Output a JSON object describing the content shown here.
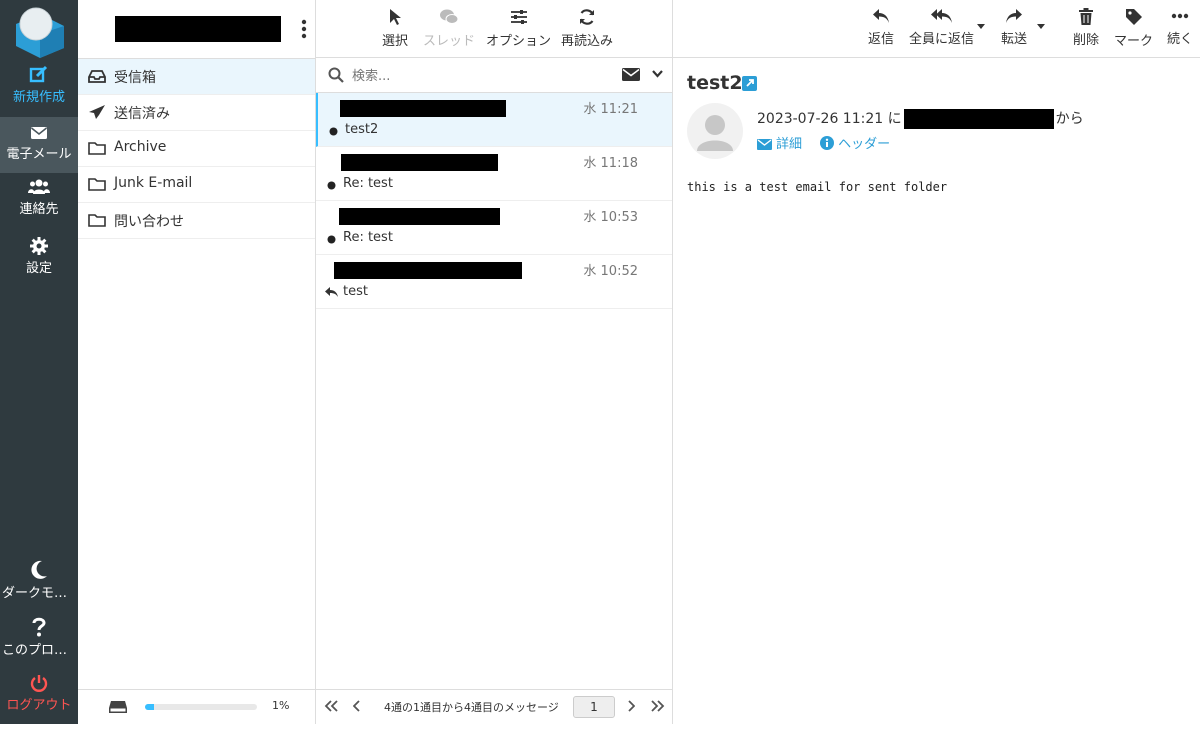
{
  "nav": {
    "compose": "新規作成",
    "mail": "電子メール",
    "contacts": "連絡先",
    "settings": "設定",
    "darkmode": "ダークモー…",
    "about": "このプログ…",
    "logout": "ログアウト"
  },
  "folders": {
    "items": [
      {
        "label": "受信箱",
        "icon": "inbox-icon"
      },
      {
        "label": "送信済み",
        "icon": "paper-plane-icon"
      },
      {
        "label": "Archive",
        "icon": "folder-icon"
      },
      {
        "label": "Junk E-mail",
        "icon": "folder-icon"
      },
      {
        "label": "問い合わせ",
        "icon": "folder-icon"
      }
    ],
    "quota": {
      "percent_label": "1%",
      "fraction": 0.08
    }
  },
  "list": {
    "toolbar": {
      "select": "選択",
      "threads": "スレッド",
      "options": "オプション",
      "refresh": "再読込み"
    },
    "search_placeholder": "検索...",
    "messages": [
      {
        "date": "水 11:21",
        "subject": "test2"
      },
      {
        "date": "水 11:18",
        "subject": "Re: test"
      },
      {
        "date": "水 10:53",
        "subject": "Re: test"
      },
      {
        "date": "水 10:52",
        "subject": "test"
      }
    ],
    "footer": {
      "info": "4通の1通目から4通目のメッセージ",
      "page": "1"
    }
  },
  "reader": {
    "toolbar": {
      "reply": "返信",
      "reply_all": "全員に返信",
      "forward": "転送",
      "delete": "削除",
      "mark": "マーク",
      "more": "続く"
    },
    "subject": "test2",
    "date": "2023-07-26 11:21",
    "from_prefix": "に",
    "from_suffix": "から",
    "details": "詳細",
    "headers": "ヘッダー",
    "body": "this is a test email for sent folder"
  },
  "colors": {
    "accent": "#37beff",
    "nav_bg": "#2f3a3f",
    "logout": "#ff5552",
    "selected_bg": "#eaf6fd"
  }
}
